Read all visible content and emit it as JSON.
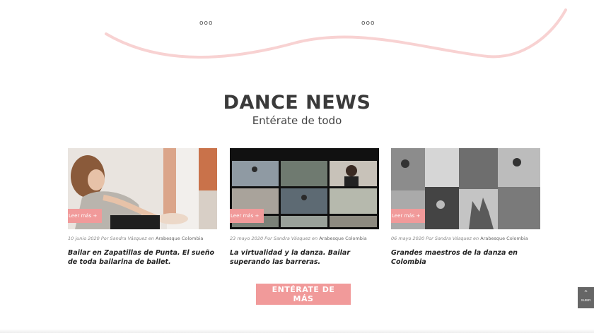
{
  "decor": {
    "dots_left": "ooo",
    "dots_right": "ooo",
    "wave_color": "#f8d2d2"
  },
  "section": {
    "title": "DANCE NEWS",
    "subtitle": "Entérate de todo"
  },
  "posts": [
    {
      "read_more": "Leer más +",
      "date": "10 junio 2020",
      "by": "Por",
      "author": "Sandra Vásquez",
      "in": "en",
      "category": "Arabesque Colombia",
      "title": "Bailar en Zapatillas de Punta. El sueño de toda bailarina de ballet."
    },
    {
      "read_more": "Leer más +",
      "date": "23 mayo 2020",
      "by": "Por",
      "author": "Sandra Vásquez",
      "in": "en",
      "category": "Arabesque Colombia",
      "title": "La virtualidad y la danza. Bailar superando las barreras."
    },
    {
      "read_more": "Leer más +",
      "date": "06 mayo 2020",
      "by": "Por",
      "author": "Sandra Vásquez",
      "in": "en",
      "category": "Arabesque Colombia",
      "title": "Grandes maestros de la danza en Colombia"
    }
  ],
  "cta": {
    "label": "ENTÉRATE DE MÁS"
  },
  "scroll_top": {
    "icon": "chevron-up-icon",
    "label": "SUBIR"
  },
  "colors": {
    "accent": "#f19a9a",
    "title": "#3a3a3a"
  }
}
